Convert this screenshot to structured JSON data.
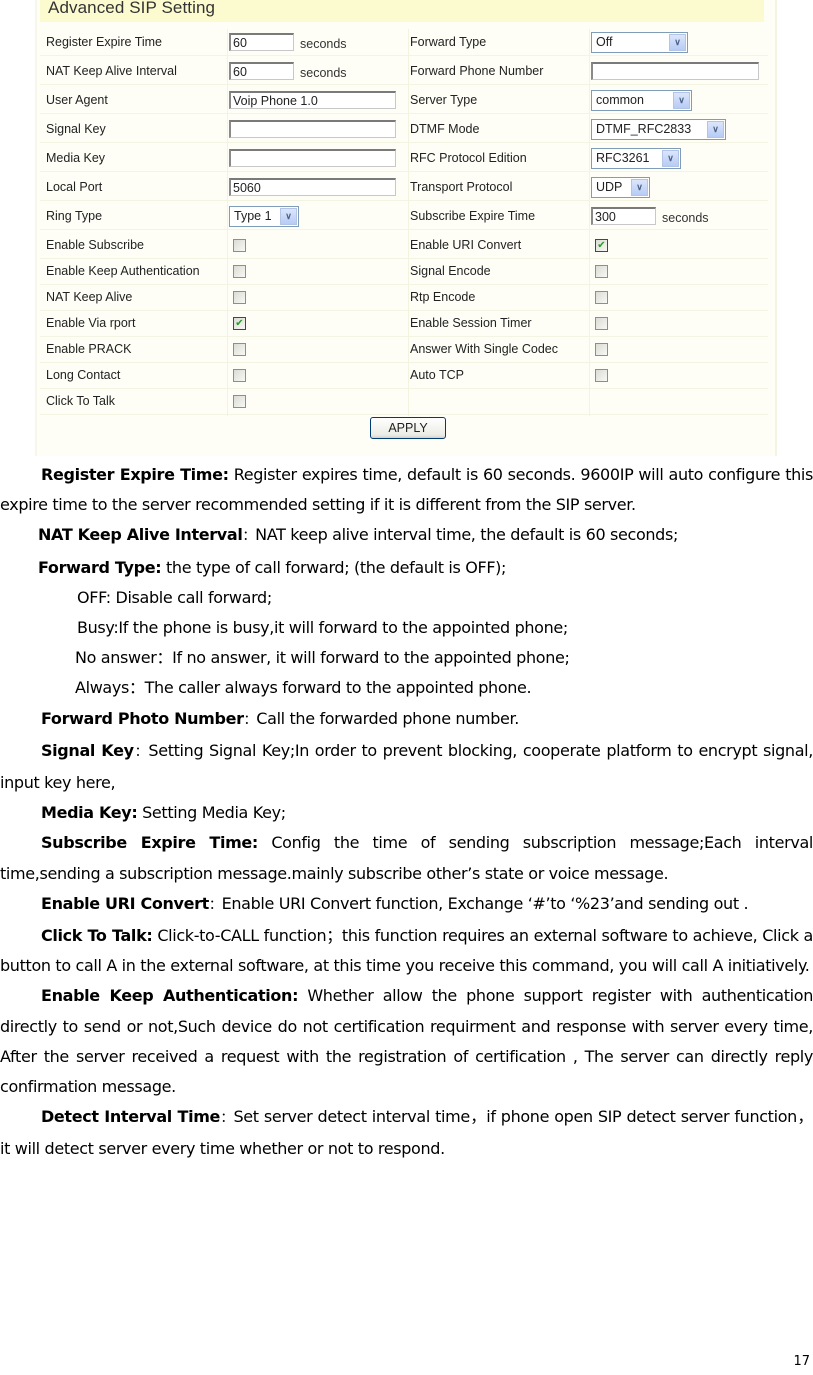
{
  "panel": {
    "title": "Advanced SIP Setting",
    "rows": [
      {
        "left_label": "Register Expire Time",
        "left_type": "text",
        "left_value": "60",
        "left_unit": "seconds",
        "right_label": "Forward Type",
        "right_type": "select",
        "right_value": "Off"
      },
      {
        "left_label": "NAT Keep Alive Interval",
        "left_type": "text",
        "left_value": "60",
        "left_unit": "seconds",
        "right_label": "Forward Phone Number",
        "right_type": "text",
        "right_value": ""
      },
      {
        "left_label": "User Agent",
        "left_type": "text",
        "left_value": "Voip Phone 1.0",
        "right_label": "Server Type",
        "right_type": "select",
        "right_value": "common"
      },
      {
        "left_label": "Signal Key",
        "left_type": "text",
        "left_value": "",
        "right_label": "DTMF Mode",
        "right_type": "select",
        "right_value": "DTMF_RFC2833"
      },
      {
        "left_label": "Media Key",
        "left_type": "text",
        "left_value": "",
        "right_label": "RFC Protocol Edition",
        "right_type": "select",
        "right_value": "RFC3261"
      },
      {
        "left_label": "Local Port",
        "left_type": "text",
        "left_value": "5060",
        "right_label": "Transport Protocol",
        "right_type": "select",
        "right_value": "UDP"
      },
      {
        "left_label": "Ring Type",
        "left_type": "select",
        "left_value": "Type 1",
        "right_label": "Subscribe Expire Time",
        "right_type": "text",
        "right_value": "300",
        "right_unit": "seconds"
      },
      {
        "left_label": "Enable Subscribe",
        "left_type": "checkbox",
        "left_checked": false,
        "right_label": "Enable URI Convert",
        "right_type": "checkbox",
        "right_checked": true
      },
      {
        "left_label": "Enable Keep Authentication",
        "left_type": "checkbox",
        "left_checked": false,
        "right_label": "Signal Encode",
        "right_type": "checkbox",
        "right_checked": false
      },
      {
        "left_label": "NAT Keep Alive",
        "left_type": "checkbox",
        "left_checked": false,
        "right_label": "Rtp Encode",
        "right_type": "checkbox",
        "right_checked": false
      },
      {
        "left_label": "Enable Via rport",
        "left_type": "checkbox",
        "left_checked": true,
        "right_label": "Enable Session Timer",
        "right_type": "checkbox",
        "right_checked": false
      },
      {
        "left_label": "Enable PRACK",
        "left_type": "checkbox",
        "left_checked": false,
        "right_label": "Answer With Single Codec",
        "right_type": "checkbox",
        "right_checked": false
      },
      {
        "left_label": "Long Contact",
        "left_type": "checkbox",
        "left_checked": false,
        "right_label": "Auto TCP",
        "right_type": "checkbox",
        "right_checked": false
      },
      {
        "left_label": "Click To Talk",
        "left_type": "checkbox",
        "left_checked": false,
        "right_label": "",
        "right_type": "none"
      }
    ],
    "apply_label": "APPLY",
    "icons": {
      "dropdown": "chevron-down-icon",
      "checked": "checkmark-icon"
    }
  },
  "doc": {
    "paragraphs": [
      {
        "term": "Register Expire Time:",
        "text": " Register expires time, default is 60 seconds. 9600IP will auto configure this expire time to the server recommended setting if it is different from the SIP server."
      },
      {
        "term": "NAT Keep Alive Interval",
        "sep": "：",
        "text": "NAT keep alive interval time, the default is 60 seconds;"
      },
      {
        "term": "Forward Type:",
        "text": " the type of call forward; (the default is OFF);"
      },
      {
        "sub": "OFF: Disable call forward;"
      },
      {
        "sub": "Busy:If the phone is busy,it will forward to the appointed phone;"
      },
      {
        "sub": "No answer：If no answer, it will forward to the appointed phone;"
      },
      {
        "sub": "Always：The caller always forward to the appointed phone."
      },
      {
        "term": "Forward Photo Number",
        "sep": "：",
        "text": "Call the forwarded phone number."
      },
      {
        "term": "Signal Key",
        "sep": "：",
        "text": "Setting Signal Key;In order to prevent blocking, cooperate platform to encrypt signal, input key here,"
      },
      {
        "term": "Media Key:",
        "text": " Setting Media Key;"
      },
      {
        "term": "Subscribe Expire Time:",
        "text": " Config the time of sending subscription message;Each interval time,sending a subscription message.mainly subscribe other’s state or voice message."
      },
      {
        "term": "Enable URI Convert",
        "sep": "：",
        "text": "Enable URI Convert function, Exchange ‘#’to ‘%23’and sending out ."
      },
      {
        "term": "Click To Talk:",
        "text": " Click-to-CALL function；this function requires an external software to achieve, Click a button to call A in the external software, at this time you receive this command, you will call A initiatively."
      },
      {
        "term": "Enable Keep Authentication:",
        "text": " Whether allow the phone support register with authentication directly to send or not,Such device do not certification requirment and response with server every time, After the server received a request with the registration of certification , The server can directly reply confirmation message."
      },
      {
        "term": "Detect Interval Time",
        "sep": "：",
        "text": "Set server detect interval time，if phone open SIP detect server function，it will detect server every time whether or not to respond."
      }
    ],
    "page_number": "17"
  }
}
